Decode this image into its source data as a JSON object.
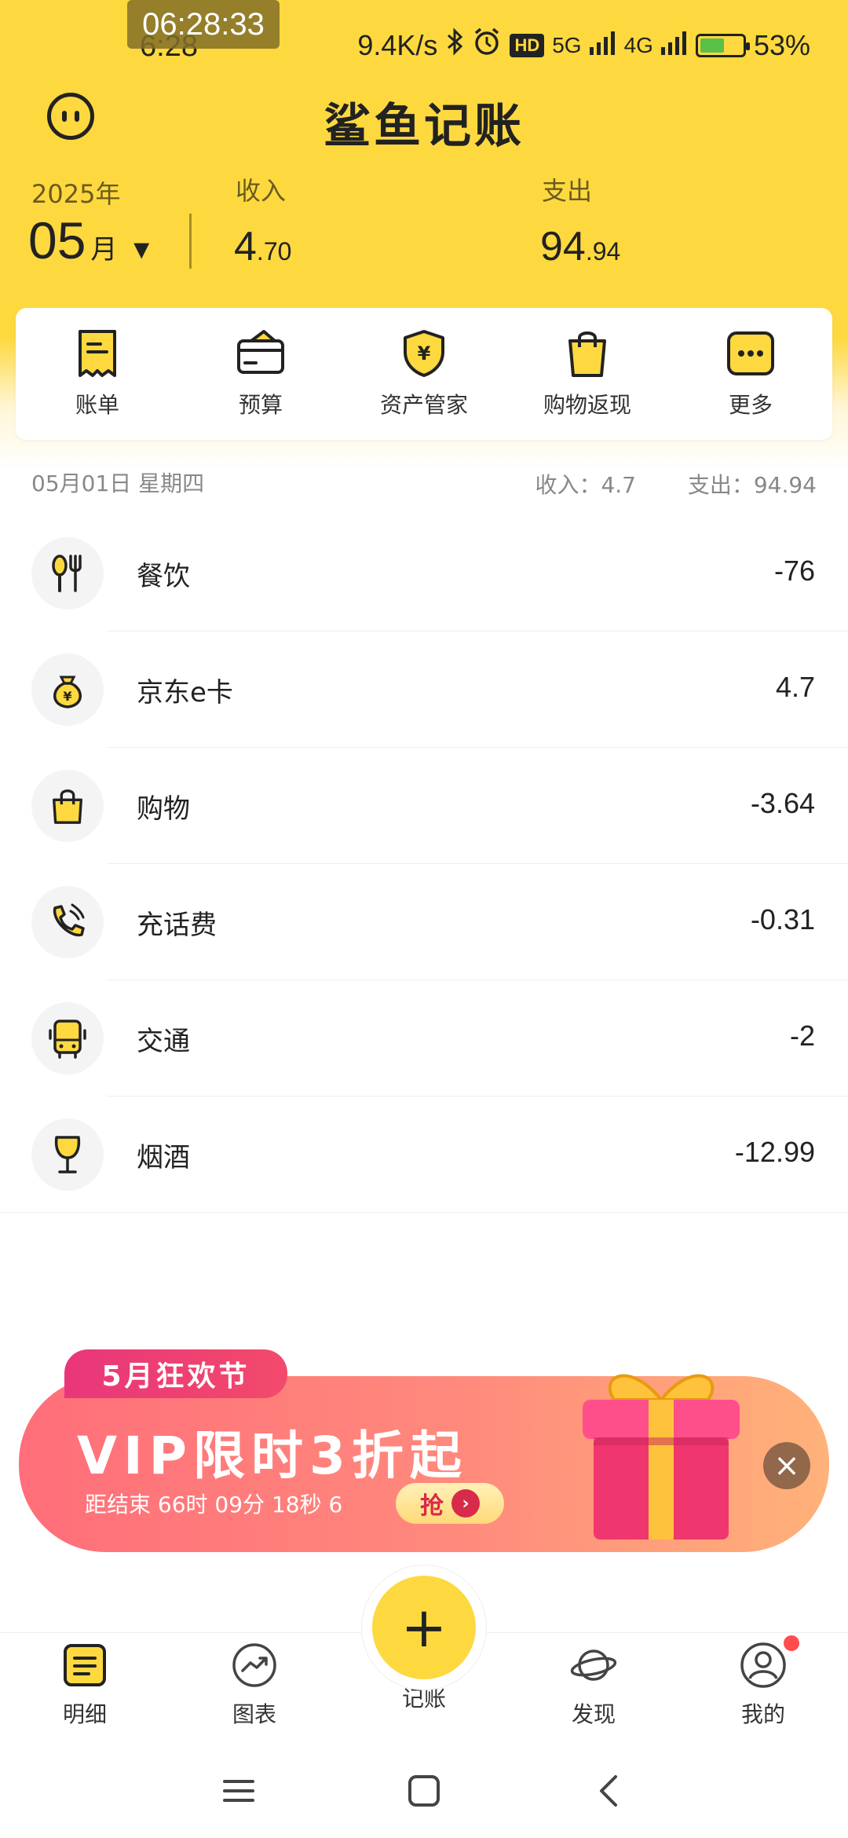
{
  "status_bar": {
    "time_overlay": "06:28:33",
    "time": "6:28",
    "network_speed": "9.4K/s",
    "hd_label": "HD",
    "signal_5g": "5G",
    "signal_4g": "4G",
    "battery": "53%"
  },
  "header": {
    "app_title": "鲨鱼记账",
    "year": "2025年",
    "month": "05",
    "month_unit": "月",
    "month_caret": "▼",
    "income_label": "收入",
    "income_int": "4",
    "income_dec": ".70",
    "expense_label": "支出",
    "expense_int": "94",
    "expense_dec": ".94"
  },
  "quick_actions": [
    {
      "label": "账单",
      "icon": "bill-icon"
    },
    {
      "label": "预算",
      "icon": "budget-icon"
    },
    {
      "label": "资产管家",
      "icon": "asset-shield-icon"
    },
    {
      "label": "购物返现",
      "icon": "shopping-bag-icon"
    },
    {
      "label": "更多",
      "icon": "more-icon"
    }
  ],
  "day_summary": {
    "date": "05月01日 星期四",
    "income": "收入：4.7",
    "expense": "支出：94.94"
  },
  "transactions": [
    {
      "category": "餐饮",
      "amount": "-76",
      "icon": "utensils-icon"
    },
    {
      "category": "京东e卡",
      "amount": "4.7",
      "icon": "money-bag-icon"
    },
    {
      "category": "购物",
      "amount": "-3.64",
      "icon": "shopping-bag-icon"
    },
    {
      "category": "充话费",
      "amount": "-0.31",
      "icon": "phone-icon"
    },
    {
      "category": "交通",
      "amount": "-2",
      "icon": "bus-icon"
    },
    {
      "category": "烟酒",
      "amount": "-12.99",
      "icon": "wine-glass-icon"
    }
  ],
  "promo": {
    "tag": "5月狂欢节",
    "title": "VIP限时3折起",
    "countdown": "距结束 66时 09分 18秒 6",
    "cta": "抢",
    "close": "×"
  },
  "tabbar": {
    "items": [
      {
        "label": "明细",
        "icon": "list-icon"
      },
      {
        "label": "图表",
        "icon": "chart-icon"
      },
      {
        "label": "记账",
        "icon": "plus-icon"
      },
      {
        "label": "发现",
        "icon": "planet-icon"
      },
      {
        "label": "我的",
        "icon": "user-icon"
      }
    ],
    "fab_symbol": "+"
  },
  "colors": {
    "brand_yellow": "#FDD93F",
    "promo_pink": "#FF6E7A",
    "badge_red": "#FF4D4F"
  }
}
